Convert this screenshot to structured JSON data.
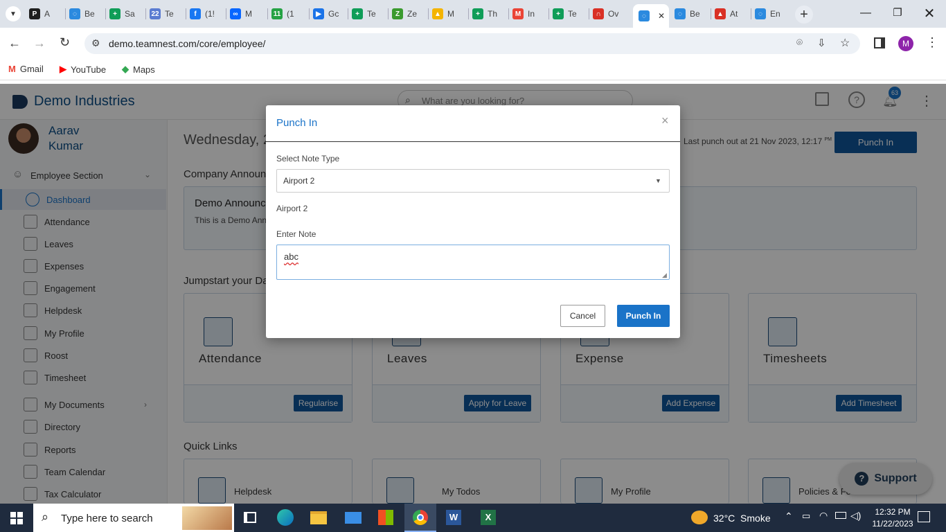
{
  "browser": {
    "tabs": [
      {
        "label": "A",
        "color": "#1e1e1e",
        "glyph": "P"
      },
      {
        "label": "Be",
        "color": "#2b8adf",
        "glyph": "◌"
      },
      {
        "label": "Sa",
        "color": "#0f9d58",
        "glyph": "+"
      },
      {
        "label": "Te",
        "color": "#5a7bd1",
        "glyph": "22"
      },
      {
        "label": "(1!",
        "color": "#1877f2",
        "glyph": "f"
      },
      {
        "label": "M",
        "color": "#0866ff",
        "glyph": "∞"
      },
      {
        "label": "(1",
        "color": "#25a244",
        "glyph": "11"
      },
      {
        "label": "Gc",
        "color": "#1a73e8",
        "glyph": "▶"
      },
      {
        "label": "Te",
        "color": "#0f9d58",
        "glyph": "+"
      },
      {
        "label": "Ze",
        "color": "#3a9a2e",
        "glyph": "Z"
      },
      {
        "label": "M",
        "color": "#f4b400",
        "glyph": "▲"
      },
      {
        "label": "Th",
        "color": "#0f9d58",
        "glyph": "+"
      },
      {
        "label": "In",
        "color": "#ea4335",
        "glyph": "M"
      },
      {
        "label": "Te",
        "color": "#0f9d58",
        "glyph": "+"
      },
      {
        "label": "Ov",
        "color": "#d93025",
        "glyph": "∩"
      },
      {
        "label": "",
        "color": "#2b8adf",
        "glyph": "◌"
      },
      {
        "label": "Be",
        "color": "#2b8adf",
        "glyph": "◌"
      },
      {
        "label": "At",
        "color": "#d93025",
        "glyph": "▲"
      },
      {
        "label": "En",
        "color": "#2b8adf",
        "glyph": "◌"
      }
    ],
    "url": "demo.teamnest.com/core/employee/",
    "bookmarks": [
      {
        "label": "Gmail",
        "color": "#ea4335",
        "glyph": "M"
      },
      {
        "label": "YouTube",
        "color": "#ff0000",
        "glyph": "▶"
      },
      {
        "label": "Maps",
        "color": "#34a853",
        "glyph": "◆"
      }
    ],
    "profile_initial": "M"
  },
  "app": {
    "company": "Demo Industries",
    "search_placeholder": "What are you looking for?",
    "notification_count": "63",
    "user_first": "Aarav",
    "user_last": "Kumar",
    "section": "Employee Section",
    "nav": [
      "Dashboard",
      "Attendance",
      "Leaves",
      "Expenses",
      "Engagement",
      "Helpdesk",
      "My Profile",
      "Roost",
      "Timesheet",
      "My Documents",
      "Directory",
      "Reports",
      "Team Calendar",
      "Tax Calculator"
    ],
    "date_text": "Wednesday, 2",
    "last_punch": "Last punch out at 21 Nov 2023, 12:17",
    "last_punch_suffix": "PM",
    "punch_in_button": "Punch In",
    "announcements_title": "Company Announ",
    "announcement_heading": "Demo Announc",
    "announcement_text": "This is a Demo Anno",
    "jumpstart_title": "Jumpstart your Da",
    "jump_cards": [
      {
        "title": "Attendance",
        "button": "Regularise"
      },
      {
        "title": "Leaves",
        "button": "Apply for Leave"
      },
      {
        "title": "Expense",
        "button": "Add Expense"
      },
      {
        "title": "Timesheets",
        "button": "Add Timesheet"
      }
    ],
    "quick_links_title": "Quick Links",
    "quick_links": [
      "Helpdesk",
      "My Todos",
      "My Profile",
      "Policies & Fo"
    ],
    "support": "Support"
  },
  "modal": {
    "title": "Punch In",
    "close": "×",
    "note_type_label": "Select Note Type",
    "note_type_value": "Airport 2",
    "note_type_echo": "Airport 2",
    "note_label": "Enter Note",
    "note_value": "abc",
    "cancel": "Cancel",
    "submit": "Punch In"
  },
  "taskbar": {
    "search_placeholder": "Type here to search",
    "weather": "32°C  Smoke",
    "time": "12:32 PM",
    "date": "11/22/2023"
  }
}
